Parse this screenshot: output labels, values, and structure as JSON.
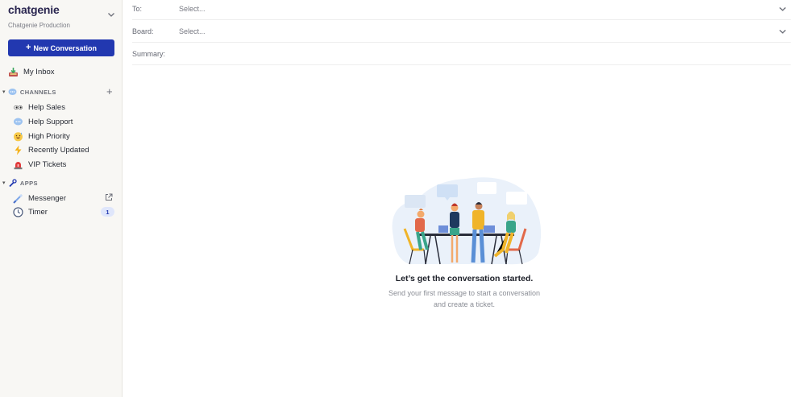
{
  "brand": {
    "name": "chatgenie",
    "workspace": "Chatgenie Production"
  },
  "sidebar": {
    "new_conversation_label": "New Conversation",
    "new_conversation_plus": "+",
    "inbox_label": "My Inbox",
    "channels": {
      "title": "CHANNELS",
      "add_symbol": "+",
      "items": [
        {
          "label": "Help Sales",
          "icon": "eyes-icon"
        },
        {
          "label": "Help Support",
          "icon": "speech-bubble-icon"
        },
        {
          "label": "High Priority",
          "icon": "sweat-smile-icon"
        },
        {
          "label": "Recently Updated",
          "icon": "lightning-icon"
        },
        {
          "label": "VIP Tickets",
          "icon": "siren-icon"
        }
      ]
    },
    "apps": {
      "title": "APPS",
      "items": [
        {
          "label": "Messenger",
          "icon": "messenger-icon"
        },
        {
          "label": "Timer",
          "icon": "clock-icon",
          "badge": "1"
        }
      ]
    }
  },
  "form": {
    "to_label": "To:",
    "to_placeholder": "Select...",
    "board_label": "Board:",
    "board_placeholder": "Select...",
    "summary_label": "Summary:"
  },
  "empty_state": {
    "title": "Let’s get the conversation started.",
    "subtitle_line1": "Send your first message to start a conversation",
    "subtitle_line2": "and create a ticket."
  },
  "colors": {
    "accent": "#2238b0",
    "sidebar_bg": "#f8f7f4",
    "badge_bg": "#dfe6fb"
  }
}
